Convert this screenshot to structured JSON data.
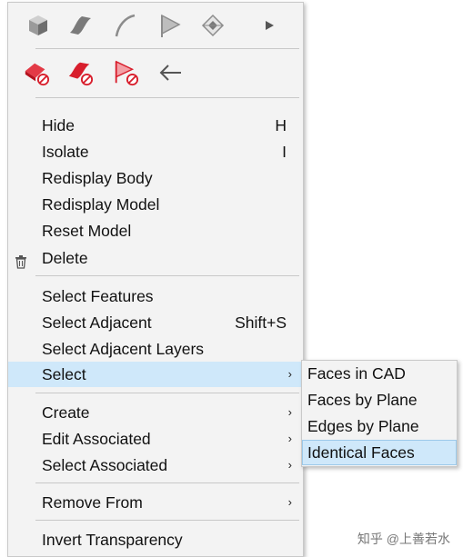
{
  "toolbar": {
    "row1_icons": [
      "solid-cube-icon",
      "surface-icon",
      "curve-icon",
      "flag-icon",
      "face-wireframe-icon",
      "more-arrow-icon"
    ],
    "row2_icons": [
      "delete-solid-icon",
      "delete-surface-icon",
      "delete-flag-icon",
      "back-arrow-icon"
    ]
  },
  "menu": {
    "items": [
      {
        "label": "Hide",
        "shortcut": "H"
      },
      {
        "label": "Isolate",
        "shortcut": "I"
      },
      {
        "label": "Redisplay Body",
        "shortcut": ""
      },
      {
        "label": "Redisplay Model",
        "shortcut": ""
      },
      {
        "label": "Reset Model",
        "shortcut": ""
      },
      {
        "label": "Delete",
        "shortcut": ""
      },
      {
        "label": "Select Features",
        "shortcut": ""
      },
      {
        "label": "Select Adjacent",
        "shortcut": "Shift+S"
      },
      {
        "label": "Select Adjacent Layers",
        "shortcut": ""
      },
      {
        "label": "Select",
        "shortcut": ""
      },
      {
        "label": "Create",
        "shortcut": ""
      },
      {
        "label": "Edit Associated",
        "shortcut": ""
      },
      {
        "label": "Select Associated",
        "shortcut": ""
      },
      {
        "label": "Remove From",
        "shortcut": ""
      },
      {
        "label": "Invert Transparency",
        "shortcut": ""
      }
    ],
    "submenu_arrow": "›"
  },
  "submenu": {
    "items": [
      {
        "label": "Faces in CAD"
      },
      {
        "label": "Faces by Plane"
      },
      {
        "label": "Edges by Plane"
      },
      {
        "label": "Identical Faces"
      }
    ]
  },
  "watermark": "知乎 @上善若水",
  "colors": {
    "highlight": "#cfe8fa",
    "menu_bg": "#f3f3f3",
    "icon_red": "#d81e2c",
    "icon_gray": "#8c8c8c"
  }
}
